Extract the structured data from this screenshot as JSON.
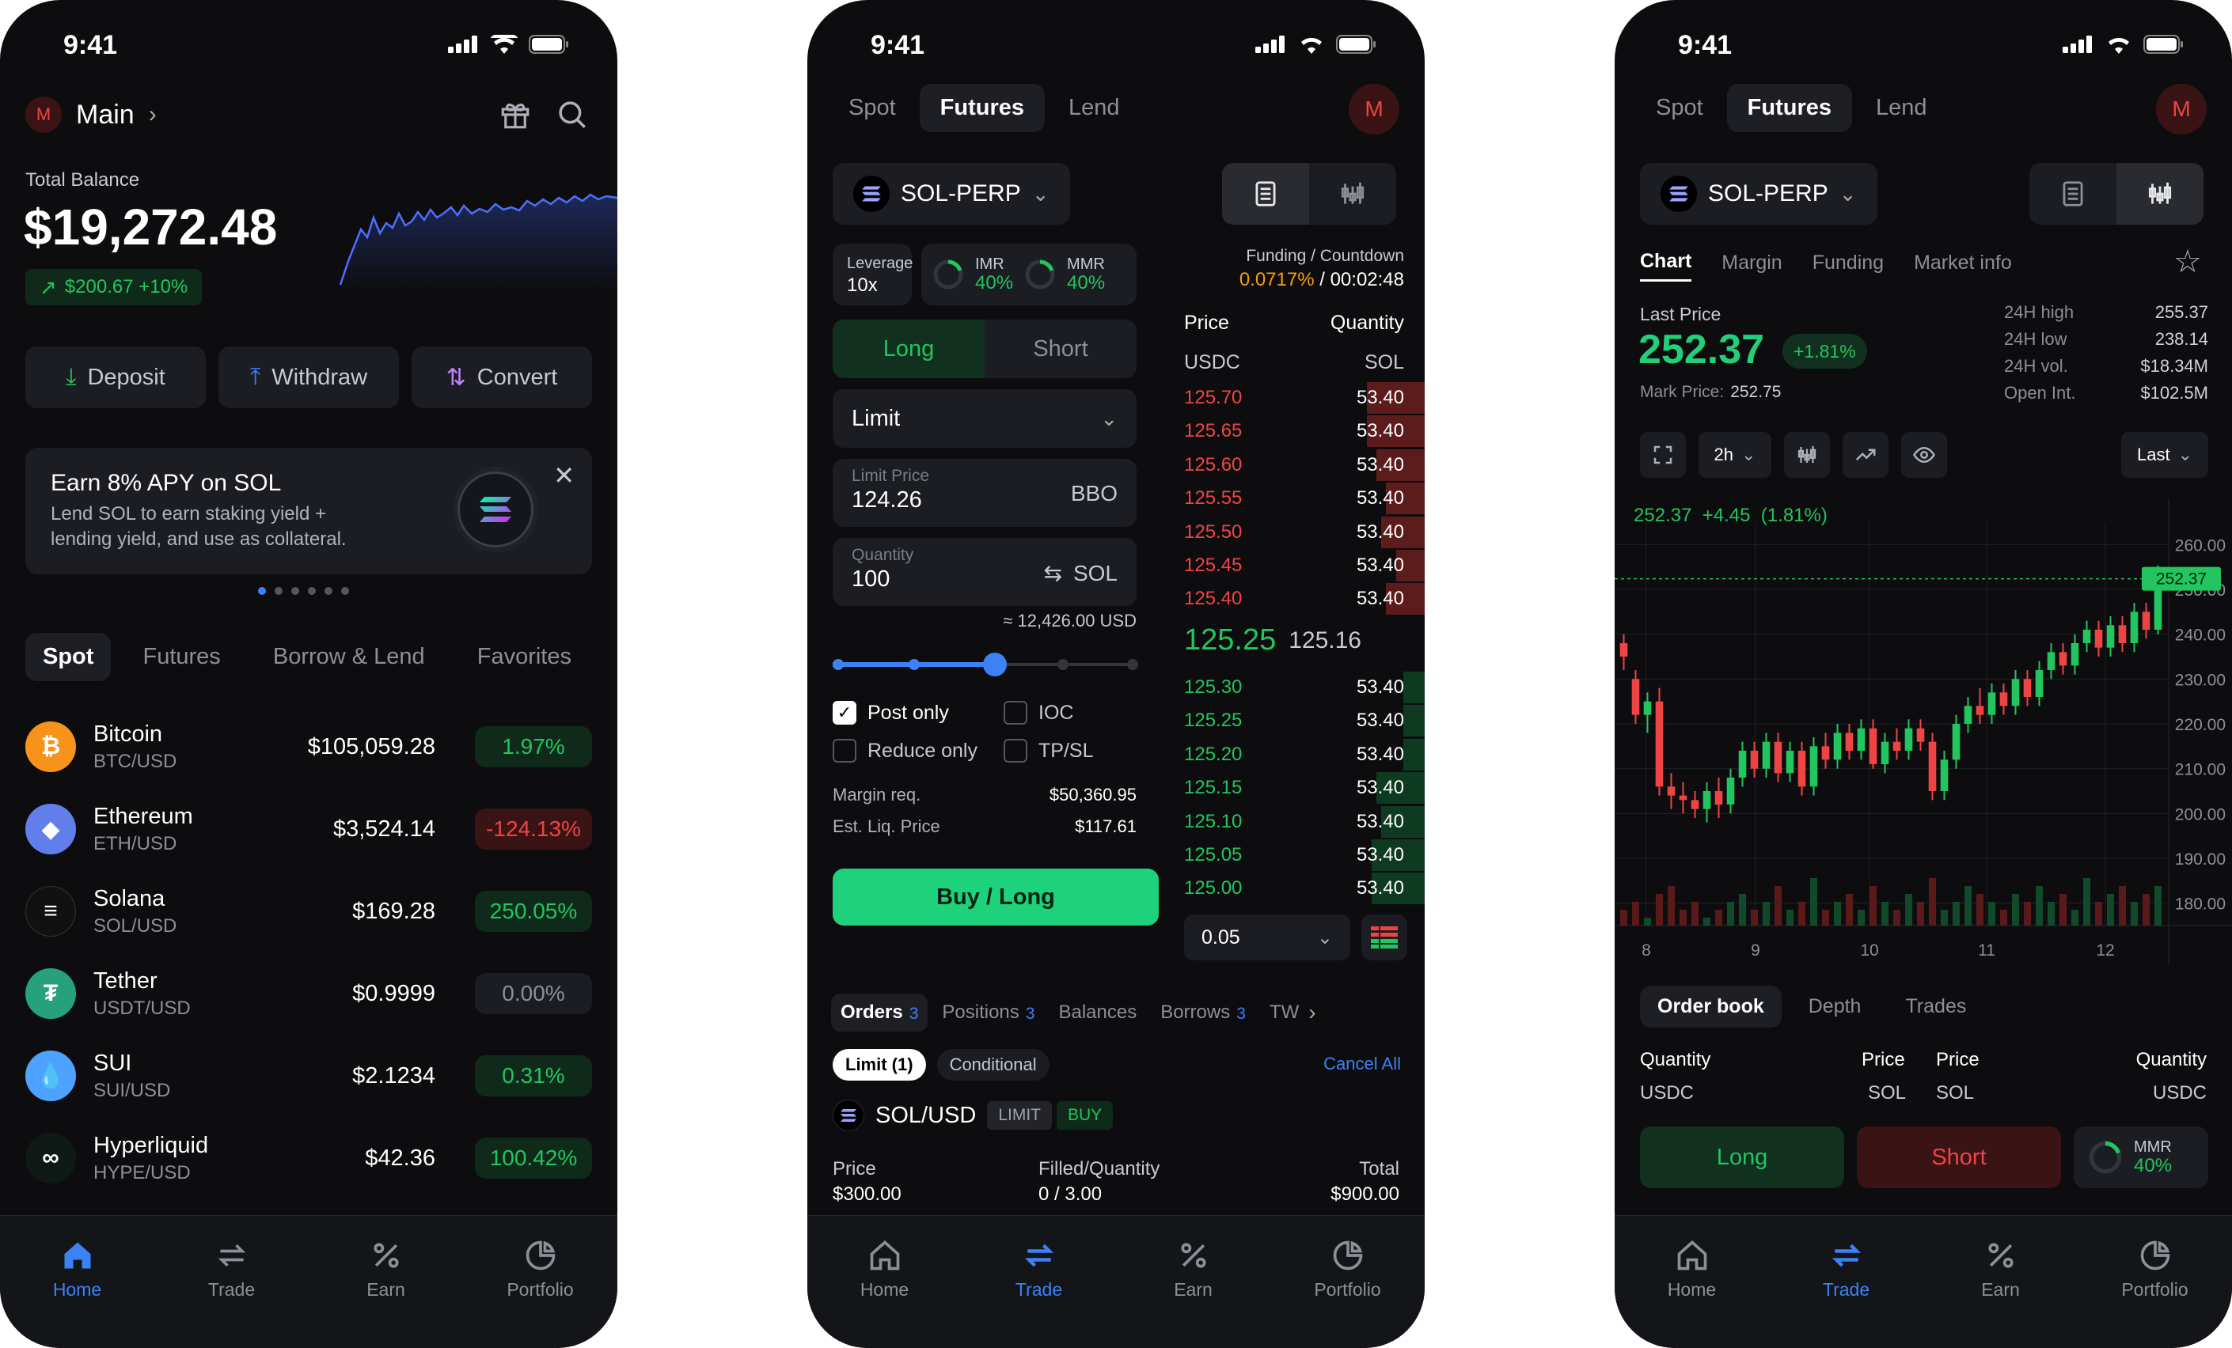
{
  "status_time": "9:41",
  "phone1": {
    "account_initial": "M",
    "account_name": "Main",
    "balance_label": "Total Balance",
    "balance_value": "$19,272.48",
    "balance_change": "$200.67 +10%",
    "actions": {
      "deposit": "Deposit",
      "withdraw": "Withdraw",
      "convert": "Convert"
    },
    "promo": {
      "title": "Earn 8% APY on SOL",
      "text1": "Lend SOL to earn staking yield +",
      "text2": "lending yield, and use as collateral."
    },
    "tabs": [
      "Spot",
      "Futures",
      "Borrow & Lend",
      "Favorites"
    ],
    "assets": [
      {
        "name": "Bitcoin",
        "pair": "BTC/USD",
        "price": "$105,059.28",
        "change": "1.97%",
        "dir": "up",
        "color": "#f7931a",
        "icon": "bitcoin-icon",
        "glyph": "₿"
      },
      {
        "name": "Ethereum",
        "pair": "ETH/USD",
        "price": "$3,524.14",
        "change": "-124.13%",
        "dir": "down",
        "color": "#627eea",
        "icon": "ethereum-icon",
        "glyph": "◆"
      },
      {
        "name": "Solana",
        "pair": "SOL/USD",
        "price": "$169.28",
        "change": "250.05%",
        "dir": "up",
        "color": "#111111",
        "icon": "solana-icon",
        "glyph": "≡"
      },
      {
        "name": "Tether",
        "pair": "USDT/USD",
        "price": "$0.9999",
        "change": "0.00%",
        "dir": "flat",
        "color": "#26a17b",
        "icon": "tether-icon",
        "glyph": "₮"
      },
      {
        "name": "SUI",
        "pair": "SUI/USD",
        "price": "$2.1234",
        "change": "0.31%",
        "dir": "up",
        "color": "#4da2ff",
        "icon": "sui-icon",
        "glyph": "💧"
      },
      {
        "name": "Hyperliquid",
        "pair": "HYPE/USD",
        "price": "$42.36",
        "change": "100.42%",
        "dir": "up",
        "color": "#0f1a17",
        "icon": "hyperliquid-icon",
        "glyph": "∞"
      }
    ]
  },
  "nav": {
    "home": "Home",
    "trade": "Trade",
    "earn": "Earn",
    "portfolio": "Portfolio"
  },
  "top_tabs": {
    "spot": "Spot",
    "futures": "Futures",
    "lend": "Lend"
  },
  "market": "SOL-PERP",
  "phone2": {
    "leverage_label": "Leverage",
    "leverage_value": "10x",
    "imr_label": "IMR",
    "imr_value": "40%",
    "mmr_label": "MMR",
    "mmr_value": "40%",
    "funding_label": "Funding / Countdown",
    "funding_rate": "0.0717%",
    "funding_sep": " / ",
    "countdown": "00:02:48",
    "long": "Long",
    "short": "Short",
    "order_type": "Limit",
    "limit_price_label": "Limit Price",
    "limit_price": "124.26",
    "bbo": "BBO",
    "quantity_label": "Quantity",
    "quantity": "100",
    "quantity_unit": "SOL",
    "usd_estimate": "≈ 12,426.00 USD",
    "post_only": "Post only",
    "ioc": "IOC",
    "reduce_only": "Reduce only",
    "tpsl": "TP/SL",
    "margin_label": "Margin req.",
    "margin_value": "$50,360.95",
    "liq_label": "Est. Liq. Price",
    "liq_value": "$117.61",
    "buy_button": "Buy / Long",
    "ob_price": "Price",
    "ob_qty": "Quantity",
    "ob_usdc": "USDC",
    "ob_sol": "SOL",
    "asks": [
      [
        "125.70",
        "53.40"
      ],
      [
        "125.65",
        "53.40"
      ],
      [
        "125.60",
        "53.40"
      ],
      [
        "125.55",
        "53.40"
      ],
      [
        "125.50",
        "53.40"
      ],
      [
        "125.45",
        "53.40"
      ],
      [
        "125.40",
        "53.40"
      ]
    ],
    "mid_price": "125.25",
    "mark_price": "125.16",
    "bids": [
      [
        "125.30",
        "53.40"
      ],
      [
        "125.25",
        "53.40"
      ],
      [
        "125.20",
        "53.40"
      ],
      [
        "125.15",
        "53.40"
      ],
      [
        "125.10",
        "53.40"
      ],
      [
        "125.05",
        "53.40"
      ],
      [
        "125.00",
        "53.40"
      ]
    ],
    "tick_size": "0.05",
    "bottom_tabs": [
      {
        "label": "Orders",
        "count": "3"
      },
      {
        "label": "Positions",
        "count": "3"
      },
      {
        "label": "Balances",
        "count": ""
      },
      {
        "label": "Borrows",
        "count": "3"
      },
      {
        "label": "TW",
        "count": ""
      }
    ],
    "filter_limit": "Limit (1)",
    "filter_conditional": "Conditional",
    "cancel_all": "Cancel All",
    "order_pair": "SOL/USD",
    "order_type_badge": "LIMIT",
    "order_side_badge": "BUY",
    "order_price_label": "Price",
    "order_price": "$300.00",
    "order_filled_label": "Filled/Quantity",
    "order_filled": "0 / 3.00",
    "order_total_label": "Total",
    "order_total": "$900.00"
  },
  "phone3": {
    "sub_tabs": [
      "Chart",
      "Margin",
      "Funding",
      "Market info"
    ],
    "last_price_label": "Last Price",
    "last_price": "252.37",
    "last_change": "+1.81%",
    "mark_price_label": "Mark Price:",
    "mark_price": "252.75",
    "stats": [
      [
        "24H high",
        "255.37"
      ],
      [
        "24H low",
        "238.14"
      ],
      [
        "24H vol.",
        "$18.34M"
      ],
      [
        "Open Int.",
        "$102.5M"
      ]
    ],
    "interval": "2h",
    "price_mode": "Last",
    "chart_header": "252.37  +4.45  (1.81%)",
    "book_tabs": [
      "Order book",
      "Depth",
      "Trades"
    ],
    "book_headers": {
      "qty": "Quantity",
      "price": "Price",
      "usdc": "USDC",
      "sol": "SOL"
    },
    "long": "Long",
    "short": "Short",
    "mmr_label": "MMR",
    "mmr_value": "40%"
  },
  "chart_data": {
    "type": "candlestick",
    "title": "SOL-PERP 2h",
    "x_ticks": [
      "8",
      "9",
      "10",
      "11",
      "12"
    ],
    "y_ticks": [
      "260.00",
      "250.00",
      "240.00",
      "230.00",
      "220.00",
      "210.00",
      "200.00",
      "190.00",
      "180.00"
    ],
    "ylim": [
      175,
      265
    ],
    "last_price_marker": "252.37",
    "candles": [
      [
        238,
        235,
        240,
        232
      ],
      [
        230,
        222,
        232,
        220
      ],
      [
        222,
        225,
        227,
        218
      ],
      [
        225,
        206,
        228,
        204
      ],
      [
        206,
        204,
        209,
        201
      ],
      [
        204,
        203,
        207,
        200
      ],
      [
        203,
        201,
        205,
        199
      ],
      [
        201,
        205,
        207,
        198
      ],
      [
        205,
        202,
        208,
        199
      ],
      [
        202,
        208,
        210,
        200
      ],
      [
        208,
        214,
        216,
        206
      ],
      [
        214,
        210,
        216,
        208
      ],
      [
        210,
        216,
        218,
        208
      ],
      [
        216,
        209,
        218,
        207
      ],
      [
        209,
        214,
        216,
        207
      ],
      [
        214,
        206,
        216,
        204
      ],
      [
        206,
        215,
        217,
        204
      ],
      [
        215,
        212,
        218,
        210
      ],
      [
        212,
        218,
        220,
        210
      ],
      [
        218,
        214,
        220,
        212
      ],
      [
        214,
        219,
        221,
        212
      ],
      [
        219,
        211,
        221,
        210
      ],
      [
        211,
        216,
        218,
        209
      ],
      [
        216,
        214,
        219,
        212
      ],
      [
        214,
        219,
        221,
        212
      ],
      [
        219,
        216,
        221,
        214
      ],
      [
        216,
        205,
        218,
        203
      ],
      [
        205,
        212,
        214,
        203
      ],
      [
        212,
        220,
        222,
        210
      ],
      [
        220,
        224,
        226,
        218
      ],
      [
        224,
        222,
        228,
        220
      ],
      [
        222,
        227,
        229,
        220
      ],
      [
        227,
        224,
        229,
        222
      ],
      [
        224,
        230,
        232,
        222
      ],
      [
        230,
        226,
        232,
        224
      ],
      [
        226,
        232,
        234,
        224
      ],
      [
        232,
        236,
        238,
        230
      ],
      [
        236,
        233,
        238,
        231
      ],
      [
        233,
        238,
        240,
        231
      ],
      [
        238,
        241,
        243,
        236
      ],
      [
        241,
        237,
        243,
        235
      ],
      [
        237,
        242,
        244,
        235
      ],
      [
        242,
        238,
        244,
        236
      ],
      [
        238,
        245,
        247,
        236
      ],
      [
        245,
        241,
        247,
        239
      ],
      [
        241,
        252.37,
        255.37,
        240
      ]
    ],
    "volume": [
      2,
      3,
      1,
      4,
      5,
      2,
      3,
      1,
      2,
      3,
      4,
      2,
      3,
      5,
      2,
      3,
      6,
      2,
      3,
      4,
      2,
      5,
      3,
      2,
      4,
      3,
      6,
      2,
      3,
      5,
      4,
      3,
      2,
      4,
      3,
      5,
      3,
      4,
      2,
      6,
      3,
      4,
      5,
      3,
      4,
      5
    ]
  }
}
